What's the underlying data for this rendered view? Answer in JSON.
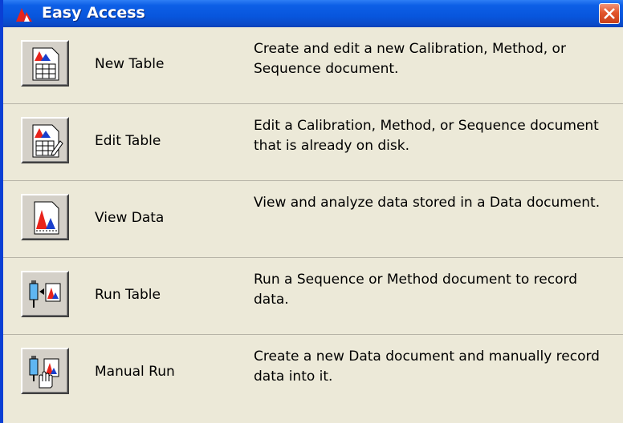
{
  "window": {
    "title": "Easy Access",
    "accent_color": "#0856dd",
    "close_color": "#e2552b"
  },
  "items": [
    {
      "label": "New Table",
      "icon": "new-table-icon",
      "description": "Create and edit a new Calibration, Method, or Sequence document."
    },
    {
      "label": "Edit Table",
      "icon": "edit-table-icon",
      "description": "Edit a Calibration, Method, or Sequence document that is already on disk."
    },
    {
      "label": "View Data",
      "icon": "view-data-icon",
      "description": "View and analyze data stored in a Data document."
    },
    {
      "label": "Run Table",
      "icon": "run-table-icon",
      "description": "Run a Sequence or Method document to record data."
    },
    {
      "label": "Manual Run",
      "icon": "manual-run-icon",
      "description": "Create a new Data document and manually record data into it."
    }
  ]
}
